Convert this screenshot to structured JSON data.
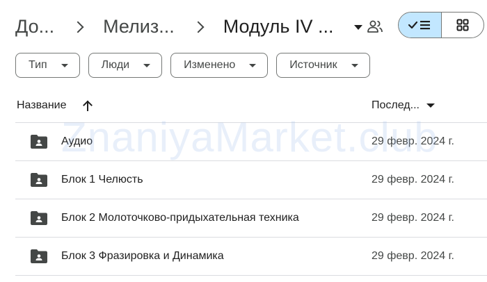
{
  "breadcrumb": {
    "items": [
      {
        "label": "До..."
      },
      {
        "label": "Мелиз..."
      },
      {
        "label": "Модуль IV ..."
      }
    ]
  },
  "filters": [
    {
      "label": "Тип"
    },
    {
      "label": "Люди"
    },
    {
      "label": "Изменено"
    },
    {
      "label": "Источник"
    }
  ],
  "table": {
    "header_name": "Название",
    "header_modified": "Послед...",
    "rows": [
      {
        "name": "Аудио",
        "modified": "29 февр. 2024 г."
      },
      {
        "name": "Блок 1 Челюсть",
        "modified": "29 февр. 2024 г."
      },
      {
        "name": "Блок 2 Молоточково-придыхательная техника",
        "modified": "29 февр. 2024 г."
      },
      {
        "name": "Блок 3 Фразировка и Динамика",
        "modified": "29 февр. 2024 г."
      }
    ]
  },
  "watermark": "ZnaniyaMarket.club",
  "colors": {
    "accent_toggle": "#c2e7ff",
    "text_primary": "#1f1f1f",
    "text_secondary": "#444746",
    "border": "#747775",
    "divider": "#dadce0"
  },
  "icons": {
    "share": "people-icon",
    "list_view": "checkmark-list-icon",
    "grid_view": "grid-icon",
    "folder": "shared-folder-icon",
    "sort": "arrow-up-icon"
  }
}
